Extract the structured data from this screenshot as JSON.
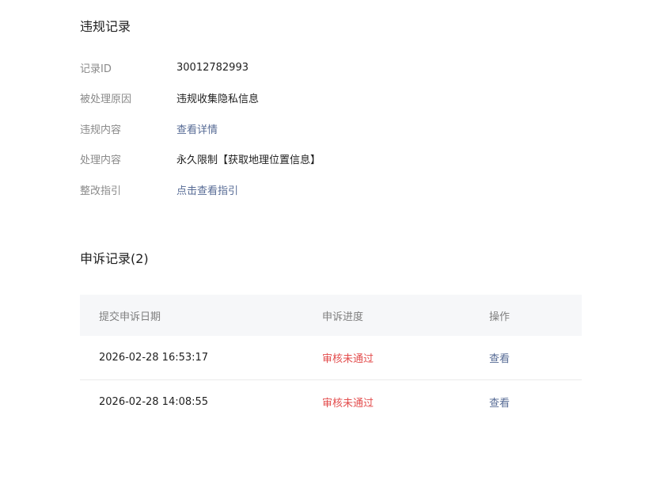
{
  "violation": {
    "title": "违规记录",
    "rows": [
      {
        "label": "记录ID",
        "value": "30012782993"
      },
      {
        "label": "被处理原因",
        "value": "违规收集隐私信息"
      },
      {
        "label": "违规内容",
        "value": "查看详情"
      },
      {
        "label": "处理内容",
        "value": "永久限制【获取地理位置信息】"
      },
      {
        "label": "整改指引",
        "value": "点击查看指引"
      }
    ]
  },
  "appeals": {
    "title": "申诉记录(2)",
    "headers": {
      "date": "提交申诉日期",
      "progress": "申诉进度",
      "action": "操作"
    },
    "rows": [
      {
        "date": "2026-02-28 16:53:17",
        "status": "审核未通过",
        "action": "查看"
      },
      {
        "date": "2026-02-28 14:08:55",
        "status": "审核未通过",
        "action": "查看"
      }
    ]
  },
  "colors": {
    "link": "#576b95",
    "status_rejected": "#e34d4d",
    "label": "#8a8a8a",
    "table_header_bg": "#f6f7f9"
  }
}
